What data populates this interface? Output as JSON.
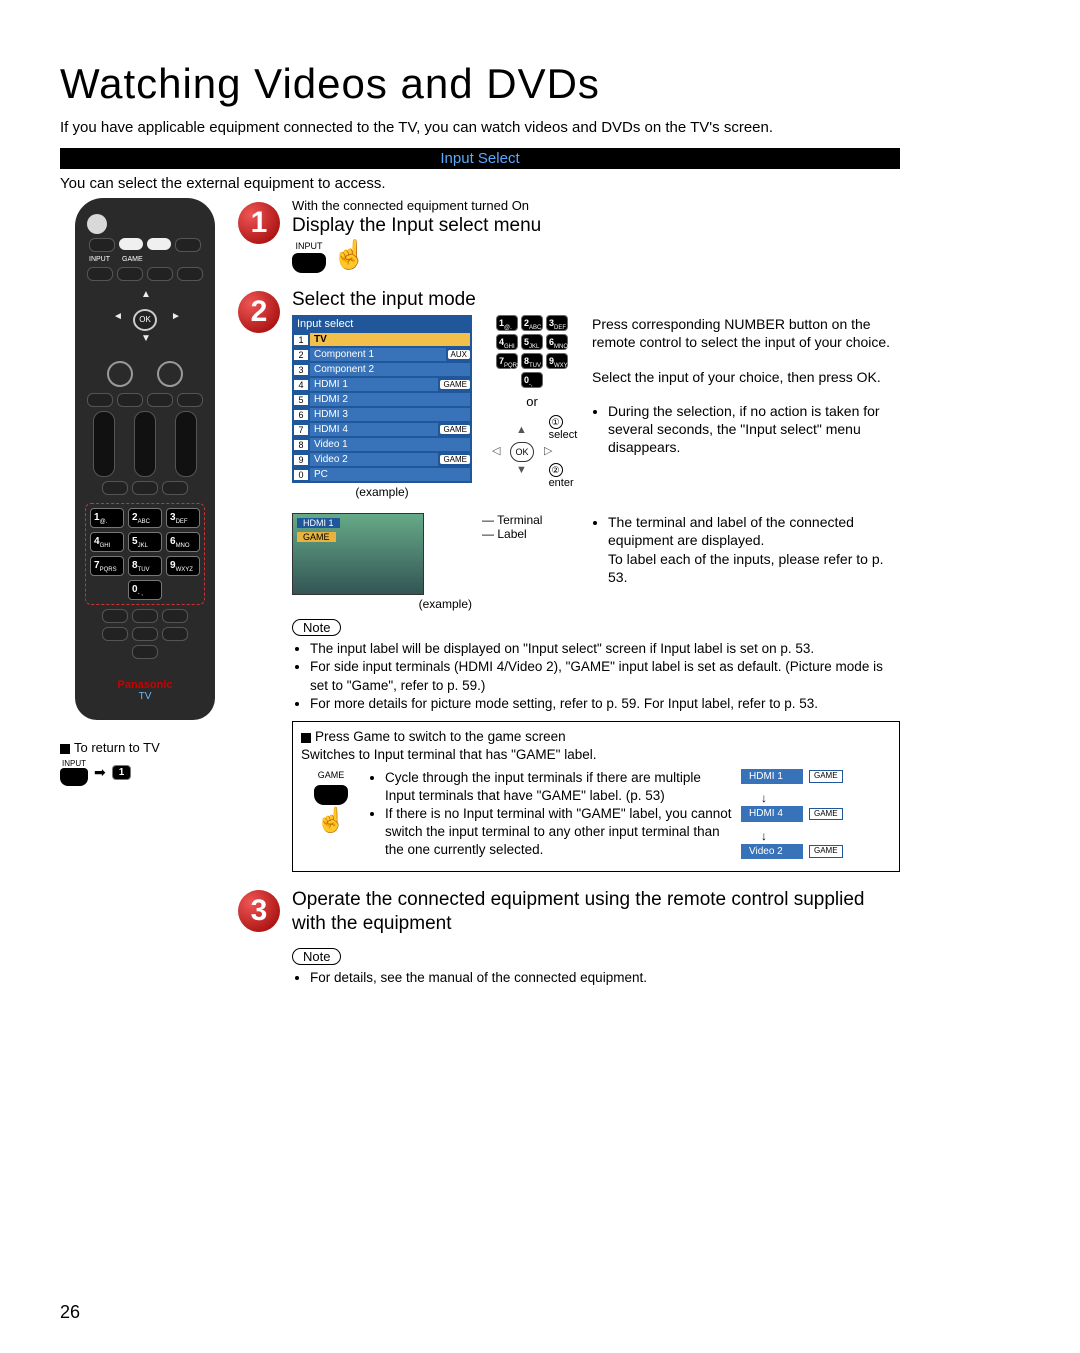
{
  "page_number": "26",
  "title": "Watching Videos and DVDs",
  "intro": "If you have applicable equipment connected to the TV, you can watch videos and DVDs on the TV's screen.",
  "section_bar": "Input Select",
  "subintro": "You can select the external equipment to access.",
  "remote": {
    "input_label": "INPUT",
    "game_label": "GAME",
    "ok": "OK",
    "numpad": [
      "1 @.",
      "2 ABC",
      "3 DEF",
      "4 GHI",
      "5 JKL",
      "6 MNO",
      "7 PQRS",
      "8 TUV",
      "9 WXYZ",
      "0 - ,"
    ],
    "brand": "Panasonic",
    "tv": "TV"
  },
  "return_tv": {
    "heading": "To return to TV",
    "input_label": "INPUT",
    "num": "1"
  },
  "step1": {
    "pre": "With the connected equipment turned On",
    "title": "Display the Input select menu",
    "btn_label": "INPUT"
  },
  "step2": {
    "title": "Select the input mode",
    "menu_header": "Input select",
    "menu_items": [
      {
        "n": "1",
        "name": "TV",
        "tag": ""
      },
      {
        "n": "2",
        "name": "Component 1",
        "tag": "AUX"
      },
      {
        "n": "3",
        "name": "Component 2",
        "tag": ""
      },
      {
        "n": "4",
        "name": "HDMI 1",
        "tag": "GAME"
      },
      {
        "n": "5",
        "name": "HDMI 2",
        "tag": ""
      },
      {
        "n": "6",
        "name": "HDMI 3",
        "tag": ""
      },
      {
        "n": "7",
        "name": "HDMI 4",
        "tag": "GAME"
      },
      {
        "n": "8",
        "name": "Video 1",
        "tag": ""
      },
      {
        "n": "9",
        "name": "Video 2",
        "tag": "GAME"
      },
      {
        "n": "0",
        "name": "PC",
        "tag": ""
      }
    ],
    "example": "(example)",
    "num_btns": [
      "1@.",
      "2ABC",
      "3DEF",
      "4GHI",
      "5JKL",
      "6MNO",
      "7PQRS",
      "8TUV",
      "9WXYZ",
      "0-,"
    ],
    "or": "or",
    "ok": "OK",
    "ok_select": "select",
    "ok_enter": "enter",
    "c1": "①",
    "c2": "②",
    "right_text_1": "Press corresponding NUMBER button on the remote control to select the input of your choice.",
    "right_text_2": "Select the input of your choice, then press OK.",
    "right_bullet_1": "During the selection, if no action is taken for several seconds, the \"Input select\" menu disappears.",
    "terminal_lbl": "Terminal",
    "label_lbl": "Label",
    "tvshot_terminal": "HDMI 1",
    "tvshot_label": "GAME",
    "right_bullet_2a": "The terminal and label of the connected equipment are displayed.",
    "right_bullet_2b": "To label each of the inputs, please refer to p. 53.",
    "note_label": "Note",
    "notes": [
      "The input label will be displayed on \"Input select\" screen if Input label is set on p. 53.",
      "For side input terminals (HDMI 4/Video 2), \"GAME\" input label is set as default. (Picture mode is set to \"Game\", refer to p. 59.)",
      "For more details for picture mode setting, refer to p. 59. For Input label, refer to p. 53."
    ],
    "game_title": "Press Game to switch to the game screen",
    "game_sub": "Switches to Input terminal that has \"GAME\" label.",
    "game_btn": "GAME",
    "game_bullets": [
      "Cycle through the input terminals if there are multiple Input terminals that have \"GAME\" label. (p. 53)",
      "If there is no Input terminal with \"GAME\" label, you cannot switch the input terminal to any other input terminal than the one currently selected."
    ],
    "cycle_items": [
      {
        "name": "HDMI 1",
        "tag": "GAME"
      },
      {
        "name": "HDMI 4",
        "tag": "GAME"
      },
      {
        "name": "Video 2",
        "tag": "GAME"
      }
    ]
  },
  "step3": {
    "title": "Operate the connected equipment using the remote control supplied with the equipment",
    "note_label": "Note",
    "note": "For details, see the manual of the connected equipment."
  }
}
